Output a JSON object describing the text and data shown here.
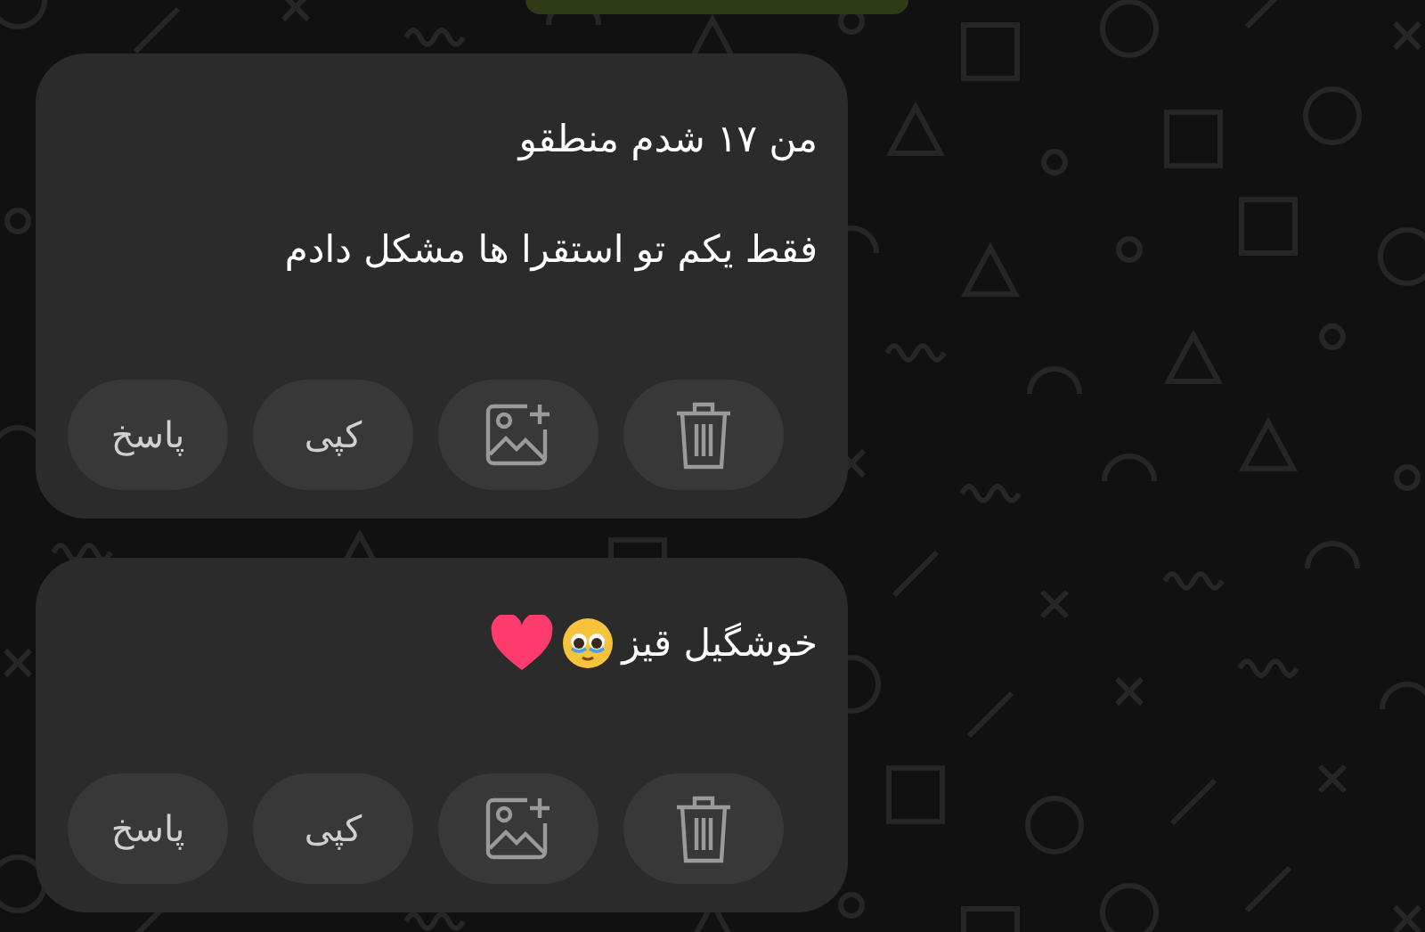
{
  "messages": [
    {
      "lines": [
        "من ۱۷ شدم منطقو",
        "فقط یکم تو استقرا ها مشکل دادم"
      ],
      "emoji": false,
      "actions": [
        {
          "kind": "delete"
        },
        {
          "kind": "add-image"
        },
        {
          "kind": "label",
          "label": "کپی"
        },
        {
          "kind": "label",
          "label": "پاسخ"
        }
      ]
    },
    {
      "lines": [
        "خوشگیل قیز"
      ],
      "emoji": true,
      "actions": [
        {
          "kind": "delete"
        },
        {
          "kind": "add-image"
        },
        {
          "kind": "label",
          "label": "کپی"
        },
        {
          "kind": "label",
          "label": "پاسخ"
        }
      ]
    }
  ]
}
